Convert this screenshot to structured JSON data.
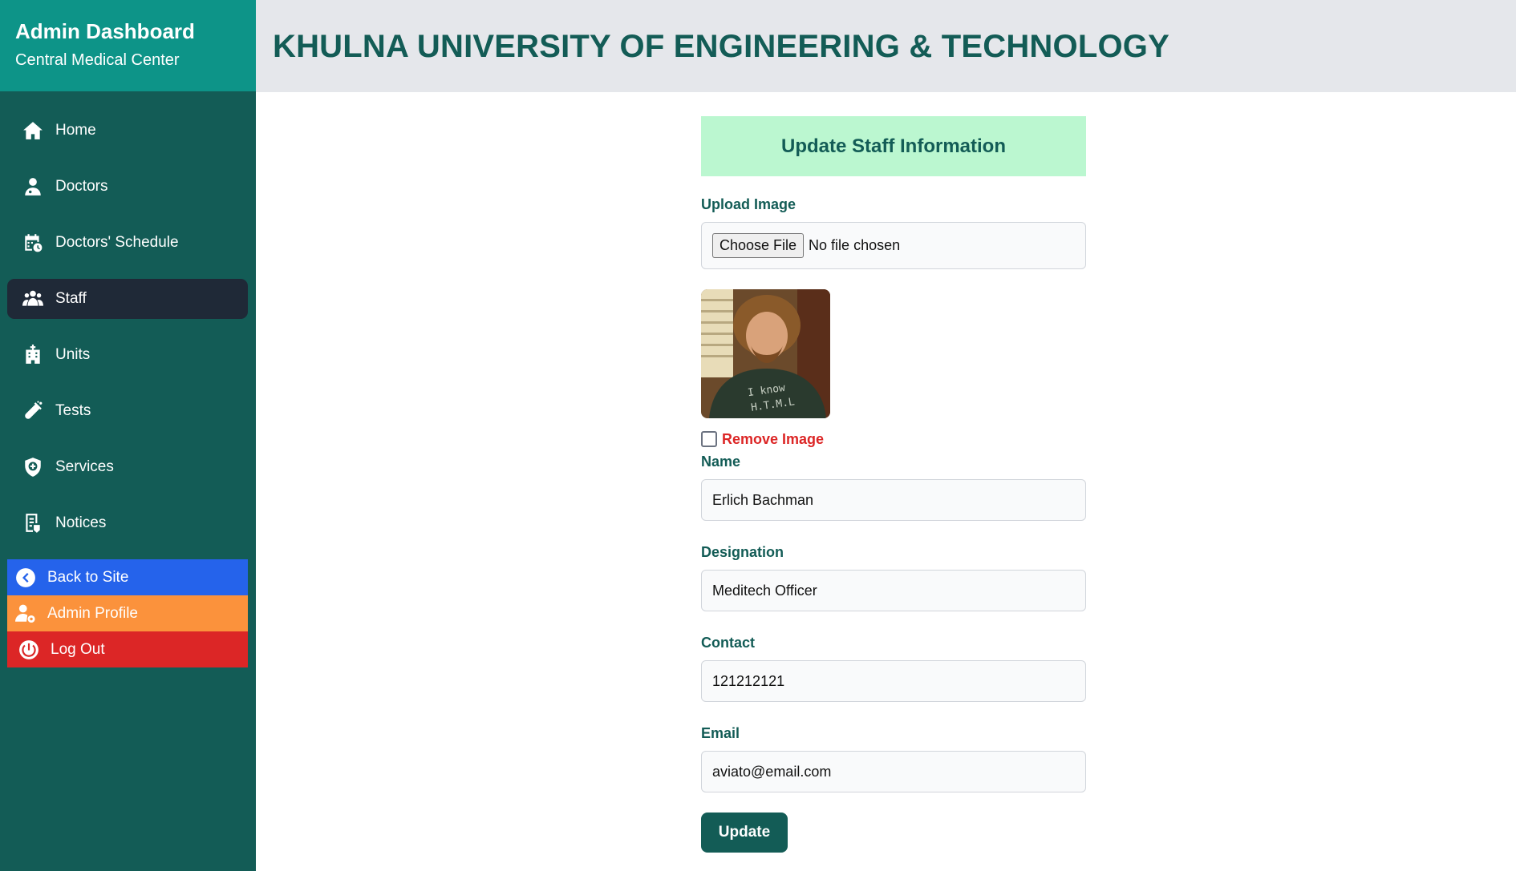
{
  "sidebar": {
    "brand_title": "Admin Dashboard",
    "brand_subtitle": "Central Medical Center",
    "items": [
      {
        "label": "Home",
        "icon": "home-icon"
      },
      {
        "label": "Doctors",
        "icon": "doctor-icon"
      },
      {
        "label": "Doctors' Schedule",
        "icon": "calendar-clock-icon"
      },
      {
        "label": "Staff",
        "icon": "users-icon",
        "active": true
      },
      {
        "label": "Units",
        "icon": "hospital-icon"
      },
      {
        "label": "Tests",
        "icon": "test-tube-icon"
      },
      {
        "label": "Services",
        "icon": "shield-plus-icon"
      },
      {
        "label": "Notices",
        "icon": "notice-icon"
      }
    ],
    "actions": {
      "back_label": "Back to Site",
      "profile_label": "Admin Profile",
      "logout_label": "Log Out"
    },
    "colors": {
      "sidebar_bg": "#135c56",
      "brand_bg": "#0d9488",
      "active_bg": "#1f2937",
      "back_bg": "#2563eb",
      "profile_bg": "#fb923c",
      "logout_bg": "#dc2626"
    }
  },
  "header": {
    "title": "KHULNA UNIVERSITY OF ENGINEERING & TECHNOLOGY"
  },
  "form": {
    "heading": "Update Staff Information",
    "upload_label": "Upload Image",
    "file_button": "Choose File",
    "file_status": "No file chosen",
    "remove_image_label": "Remove Image",
    "remove_image_checked": false,
    "fields": {
      "name": {
        "label": "Name",
        "value": "Erlich Bachman"
      },
      "designation": {
        "label": "Designation",
        "value": "Meditech Officer"
      },
      "contact": {
        "label": "Contact",
        "value": "121212121"
      },
      "email": {
        "label": "Email",
        "value": "aviato@email.com"
      }
    },
    "submit_label": "Update",
    "colors": {
      "banner_bg": "#bbf7d0",
      "primary": "#135c56",
      "danger": "#dc2626"
    }
  }
}
